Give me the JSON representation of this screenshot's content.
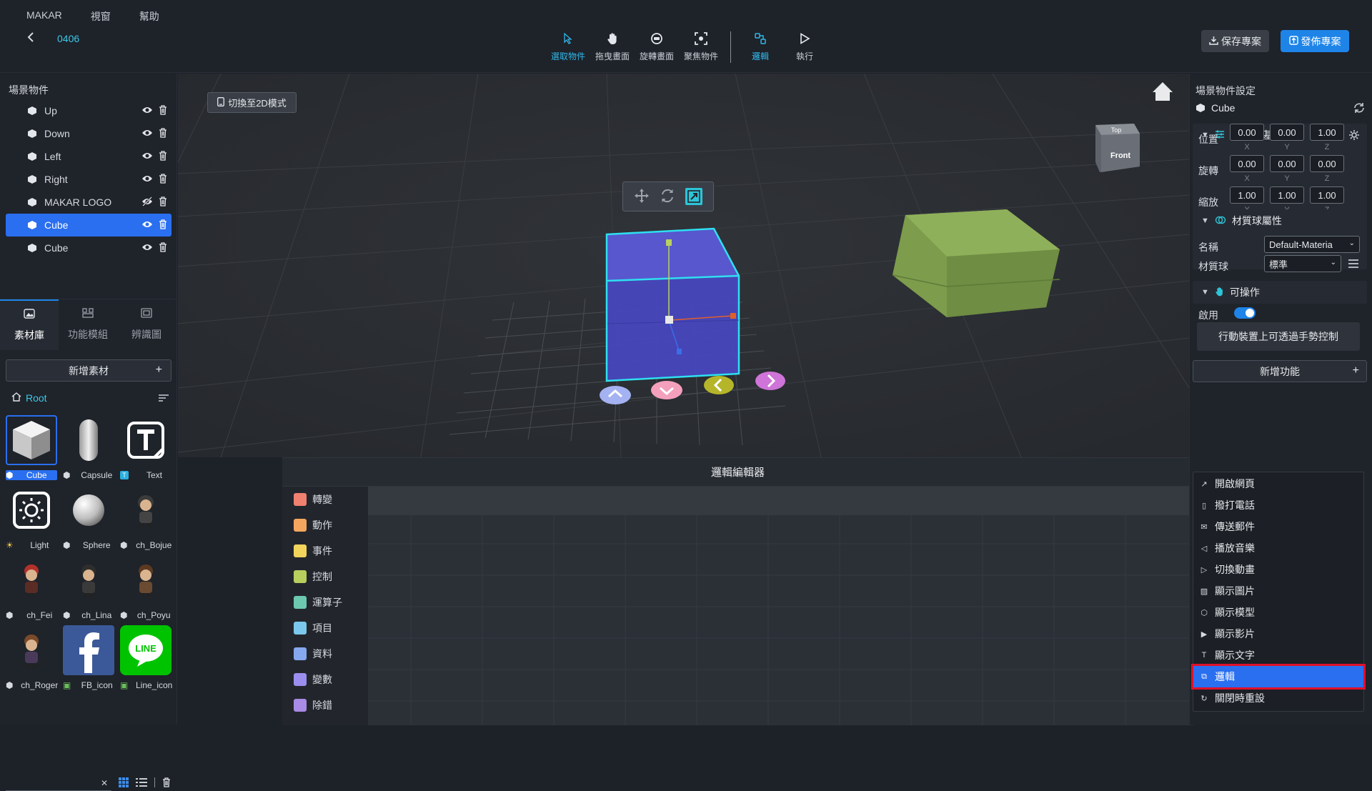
{
  "menu": {
    "items": [
      "MAKAR",
      "視窗",
      "幫助"
    ]
  },
  "project": {
    "name": "0406"
  },
  "toolbar": {
    "tools": [
      {
        "label": "選取物件",
        "icon": "cursor-icon",
        "active": true
      },
      {
        "label": "拖曳畫面",
        "icon": "hand-icon",
        "active": false
      },
      {
        "label": "旋轉畫面",
        "icon": "rotate-view-icon",
        "active": false
      },
      {
        "label": "聚焦物件",
        "icon": "focus-icon",
        "active": false
      }
    ],
    "logic_label": "邏輯",
    "run_label": "執行",
    "save_label": "保存專案",
    "publish_label": "發佈專案"
  },
  "scene": {
    "title": "場景物件",
    "items": [
      {
        "label": "Up",
        "visible": true,
        "selected": false
      },
      {
        "label": "Down",
        "visible": true,
        "selected": false
      },
      {
        "label": "Left",
        "visible": true,
        "selected": false
      },
      {
        "label": "Right",
        "visible": true,
        "selected": false
      },
      {
        "label": "MAKAR LOGO",
        "visible": false,
        "selected": false
      },
      {
        "label": "Cube",
        "visible": true,
        "selected": true
      },
      {
        "label": "Cube",
        "visible": true,
        "selected": false
      }
    ]
  },
  "library": {
    "tabs": [
      "素材庫",
      "功能模組",
      "辨識圖"
    ],
    "add_label": "新增素材",
    "root_label": "Root",
    "assets": [
      "Cube",
      "Capsule",
      "Text",
      "Light",
      "Sphere",
      "ch_Bojue",
      "ch_Fei",
      "ch_Lina",
      "ch_Poyu",
      "ch_Roger",
      "FB_icon",
      "Line_icon"
    ],
    "line_logo_text": "LINE",
    "search_placeholder": ""
  },
  "viewport": {
    "switch_2d_label": "切換至2D模式",
    "view_cube_top": "Top",
    "view_cube_front": "Front"
  },
  "logic_editor": {
    "title": "邏輯編輯器",
    "categories": [
      {
        "label": "轉變",
        "color": "#f08070"
      },
      {
        "label": "動作",
        "color": "#f4a65e"
      },
      {
        "label": "事件",
        "color": "#f2d45c"
      },
      {
        "label": "控制",
        "color": "#b8cf5e"
      },
      {
        "label": "運算子",
        "color": "#6cc9b0"
      },
      {
        "label": "項目",
        "color": "#7cc8ec"
      },
      {
        "label": "資料",
        "color": "#86a8ee"
      },
      {
        "label": "變數",
        "color": "#9c8eee"
      },
      {
        "label": "除錯",
        "color": "#a98ae6"
      }
    ]
  },
  "inspector": {
    "title": "場景物件設定",
    "object_name": "Cube",
    "basic_section": "3D物件基本屬性",
    "position_label": "位置",
    "rotation_label": "旋轉",
    "scale_label": "縮放",
    "position": [
      "0.00",
      "0.00",
      "1.00"
    ],
    "rotation": [
      "0.00",
      "0.00",
      "0.00"
    ],
    "scale": [
      "1.00",
      "1.00",
      "1.00"
    ],
    "axes": [
      "X",
      "Y",
      "Z"
    ],
    "material_section": "材質球屬性",
    "name_label": "名稱",
    "name_value": "Default-Materia",
    "material_label": "材質球",
    "material_value": "標準",
    "interact_section": "可操作",
    "enable_label": "啟用",
    "mobile_label": "行動裝置上可透過手勢控制",
    "add_function_label": "新增功能"
  },
  "function_menu": {
    "items": [
      "開啟網頁",
      "撥打電話",
      "傳送郵件",
      "播放音樂",
      "切換動畫",
      "顯示圖片",
      "顯示模型",
      "顯示影片",
      "顯示文字",
      "邏輯",
      "關閉時重設"
    ],
    "highlighted": "邏輯"
  }
}
